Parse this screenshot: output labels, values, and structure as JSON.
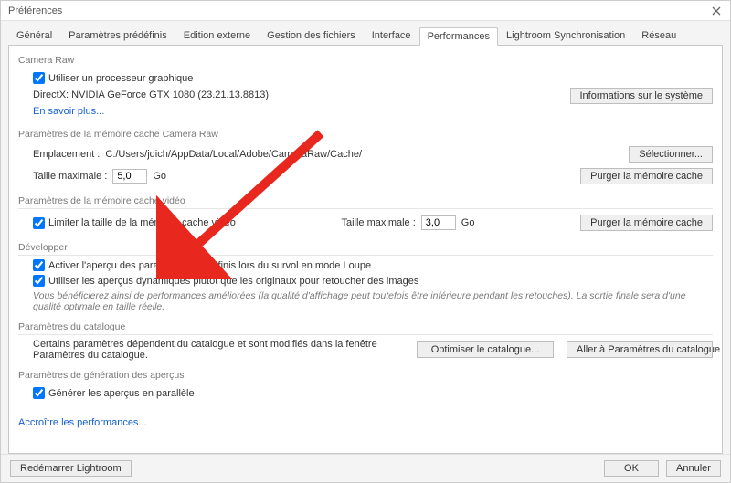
{
  "window": {
    "title": "Préférences"
  },
  "tabs": {
    "items": [
      {
        "label": "Général"
      },
      {
        "label": "Paramètres prédéfinis"
      },
      {
        "label": "Edition externe"
      },
      {
        "label": "Gestion des fichiers"
      },
      {
        "label": "Interface"
      },
      {
        "label": "Performances"
      },
      {
        "label": "Lightroom Synchronisation"
      },
      {
        "label": "Réseau"
      }
    ],
    "active_index": 5
  },
  "camera_raw": {
    "title": "Camera Raw",
    "use_gpu_label": "Utiliser un processeur graphique",
    "gpu_line": "DirectX: NVIDIA GeForce GTX 1080 (23.21.13.8813)",
    "learn_more": "En savoir plus...",
    "system_info_btn": "Informations sur le système"
  },
  "raw_cache": {
    "title": "Paramètres de la mémoire cache Camera Raw",
    "location_label": "Emplacement :",
    "location_value": "C:/Users/jdich/AppData/Local/Adobe/CameraRaw/Cache/",
    "choose_btn": "Sélectionner...",
    "max_size_label": "Taille maximale :",
    "max_size_value": "5,0",
    "unit": "Go",
    "purge_btn": "Purger la mémoire cache"
  },
  "video_cache": {
    "title": "Paramètres de la mémoire cache vidéo",
    "limit_label": "Limiter la taille de la mémoire cache vidéo",
    "max_size_label": "Taille maximale :",
    "max_size_value": "3,0",
    "unit": "Go",
    "purge_btn": "Purger la mémoire cache"
  },
  "develop": {
    "title": "Développer",
    "preview_presets_label": "Activer l'aperçu des paramètres prédéfinis lors du survol en mode Loupe",
    "smart_previews_label": "Utiliser les aperçus dynamiques plutôt que les originaux pour retoucher des images",
    "note": "Vous bénéficierez ainsi de performances améliorées (la qualité d'affichage peut toutefois être inférieure pendant les retouches). La sortie finale sera d'une qualité optimale en taille réelle."
  },
  "catalog": {
    "title": "Paramètres du catalogue",
    "note": "Certains paramètres dépendent du catalogue et sont modifiés dans la fenêtre Paramètres du catalogue.",
    "optimize_btn": "Optimiser le catalogue...",
    "go_btn": "Aller à Paramètres du catalogue"
  },
  "preview_gen": {
    "title": "Paramètres de génération des aperçus",
    "parallel_label": "Générer les aperçus en parallèle"
  },
  "performance_link": "Accroître les performances...",
  "footer": {
    "restart": "Redémarrer Lightroom",
    "ok": "OK",
    "cancel": "Annuler"
  }
}
